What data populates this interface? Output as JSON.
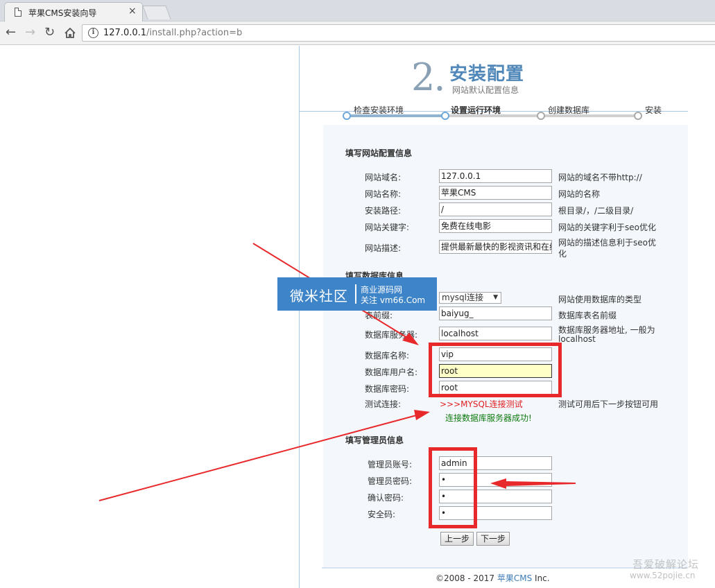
{
  "browser": {
    "tab_title": "苹果CMS安装向导",
    "tab_close": "×",
    "url_host": "127.0.0.1",
    "url_rest": "/install.php?action=b"
  },
  "header": {
    "step_number": "2.",
    "title": "安装配置",
    "subtitle": "网站默认配置信息"
  },
  "steps": [
    {
      "label": "检查安装环境",
      "state": "done"
    },
    {
      "label": "设置运行环境",
      "state": "current"
    },
    {
      "label": "创建数据库",
      "state": "todo"
    },
    {
      "label": "安装",
      "state": "todo"
    }
  ],
  "site_section": {
    "title": "填写网站配置信息",
    "fields": [
      {
        "label": "网站域名:",
        "value": "127.0.0.1",
        "hint": "网站的域名不带http://"
      },
      {
        "label": "网站名称:",
        "value": "苹果CMS",
        "hint": "网站的名称"
      },
      {
        "label": "安装路径:",
        "value": "/",
        "hint": "根目录/，/二级目录/"
      },
      {
        "label": "网站关键字:",
        "value": "免费在线电影",
        "hint": "网站的关键字利于seo优化"
      },
      {
        "label": "网站描述:",
        "value": "提供最新最快的影视资讯和在线",
        "hint_line1": "网站的描述信息利于seo优",
        "hint_line2": "化"
      }
    ]
  },
  "db_section": {
    "title": "填写数据库信息",
    "db_type_value": "mysql连接",
    "db_type_hint": "网站使用数据库的类型",
    "prefix_label": "表前缀:",
    "prefix_value": "baiyug_",
    "prefix_hint": "数据库表名前缀",
    "server_label": "数据库服务器:",
    "server_value": "localhost",
    "server_hint_line1": "数据库服务器地址, 一般为",
    "server_hint_line2": "localhost",
    "name_label": "数据库名称:",
    "name_value": "vip",
    "user_label": "数据库用户名:",
    "user_value": "root",
    "pass_label": "数据库密码:",
    "pass_value": "root",
    "test_label": "测试连接:",
    "test_link": ">>>MYSQL连接测试",
    "test_hint": "测试可用后下一步按钮可用",
    "test_result": "连接数据库服务器成功!"
  },
  "admin_section": {
    "title": "填写管理员信息",
    "account_label": "管理员账号:",
    "account_value": "admin",
    "password_label": "管理员密码:",
    "password_value": "•",
    "confirm_label": "确认密码:",
    "confirm_value": "•",
    "code_label": "安全码:",
    "code_value": "•"
  },
  "buttons": {
    "prev": "上一步",
    "next": "下一步"
  },
  "footer": {
    "prefix": "©2008 - 2017 ",
    "brand": "苹果CMS",
    "suffix": " Inc."
  },
  "watermark": {
    "badge_main": "微米社区",
    "badge_line1": "商业源码网",
    "badge_line2": "关注 vm66.Com",
    "corner_line1": "吾爱破解论坛",
    "corner_line2": "www.52pojie.cn"
  },
  "colors": {
    "accent": "#4f87b8",
    "highlight_box": "#e8292c",
    "badge_bg": "#3e84c8",
    "success": "#0f7a0f",
    "link_red": "#e02020"
  }
}
